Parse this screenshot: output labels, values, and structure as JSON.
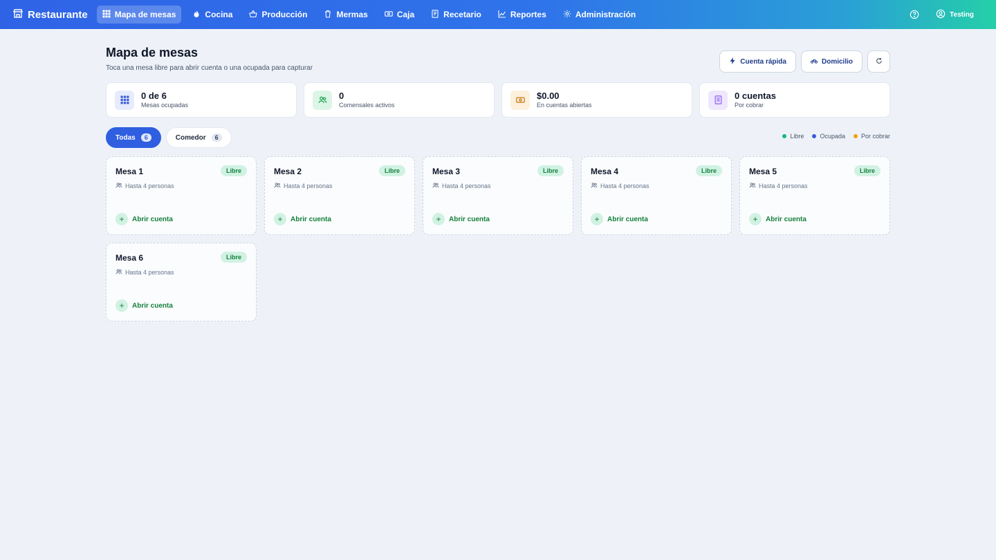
{
  "app": {
    "brand": "Restaurante"
  },
  "nav": [
    {
      "label": "Mapa de mesas",
      "icon": "grid-icon",
      "active": true
    },
    {
      "label": "Cocina",
      "icon": "flame-icon",
      "active": false
    },
    {
      "label": "Producción",
      "icon": "basket-icon",
      "active": false
    },
    {
      "label": "Mermas",
      "icon": "trash-icon",
      "active": false
    },
    {
      "label": "Caja",
      "icon": "cash-icon",
      "active": false
    },
    {
      "label": "Recetario",
      "icon": "book-icon",
      "active": false
    },
    {
      "label": "Reportes",
      "icon": "chart-line-icon",
      "active": false
    },
    {
      "label": "Administración",
      "icon": "gear-icon",
      "active": false
    }
  ],
  "user": {
    "name": "Testing"
  },
  "header": {
    "title": "Mapa de mesas",
    "subtitle": "Toca una mesa libre para abrir cuenta o una ocupada para capturar",
    "quick_account": "Cuenta rápida",
    "delivery": "Domicilio"
  },
  "stats": [
    {
      "value": "0 de 6",
      "label": "Mesas ocupadas",
      "icon": "grid-icon",
      "color": "#3b5bdb",
      "bg": "#e6ecfd"
    },
    {
      "value": "0",
      "label": "Comensales activos",
      "icon": "users-icon",
      "color": "#16a34a",
      "bg": "#dcf5e7"
    },
    {
      "value": "$0.00",
      "label": "En cuentas abiertas",
      "icon": "cash-icon",
      "color": "#c2730f",
      "bg": "#fdf0dc"
    },
    {
      "value": "0 cuentas",
      "label": "Por cobrar",
      "icon": "receipt-icon",
      "color": "#8b5cf6",
      "bg": "#efe7fd"
    }
  ],
  "filters": [
    {
      "label": "Todas",
      "count": "6",
      "active": true
    },
    {
      "label": "Comedor",
      "count": "6",
      "active": false
    }
  ],
  "legend": [
    {
      "label": "Libre",
      "color": "#10b981"
    },
    {
      "label": "Ocupada",
      "color": "#3b5bdb"
    },
    {
      "label": "Por cobrar",
      "color": "#f59e0b"
    }
  ],
  "tables": [
    {
      "name": "Mesa 1",
      "status": "Libre",
      "capacity": "Hasta 4 personas",
      "action": "Abrir cuenta"
    },
    {
      "name": "Mesa 2",
      "status": "Libre",
      "capacity": "Hasta 4 personas",
      "action": "Abrir cuenta"
    },
    {
      "name": "Mesa 3",
      "status": "Libre",
      "capacity": "Hasta 4 personas",
      "action": "Abrir cuenta"
    },
    {
      "name": "Mesa 4",
      "status": "Libre",
      "capacity": "Hasta 4 personas",
      "action": "Abrir cuenta"
    },
    {
      "name": "Mesa 5",
      "status": "Libre",
      "capacity": "Hasta 4 personas",
      "action": "Abrir cuenta"
    },
    {
      "name": "Mesa 6",
      "status": "Libre",
      "capacity": "Hasta 4 personas",
      "action": "Abrir cuenta"
    }
  ]
}
